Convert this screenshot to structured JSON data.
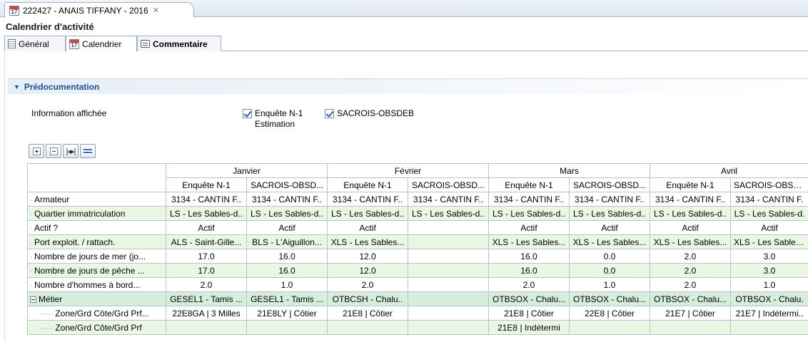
{
  "editor_tab": {
    "title": "222427 - ANAIS TIFFANY - 2016",
    "icon": "calendar-icon"
  },
  "form": {
    "title": "Calendrier d'activité"
  },
  "subtabs": [
    {
      "label": "Général",
      "icon": "document-icon"
    },
    {
      "label": "Calendrier",
      "icon": "calendar-icon"
    },
    {
      "label": "Commentaire",
      "icon": "comment-icon"
    }
  ],
  "section": {
    "title": "Prédocumentation"
  },
  "info": {
    "label": "Information affichée",
    "check1_line1": "Enquête N-1",
    "check1_line2": "Estimation",
    "check2": "SACROIS-OBSDEB"
  },
  "grid": {
    "months": [
      "Janvier",
      "Février",
      "Mars",
      "Avril"
    ],
    "subheaders": [
      "Enquête N-1",
      "SACROIS-OBSD...",
      "Enquête N-1",
      "SACROIS-OBSD...",
      "Enquête N-1",
      "SACROIS-OBSD...",
      "Enquête N-1",
      "SACROIS-OBSD..."
    ],
    "rows": [
      {
        "label": "Armateur",
        "style": "white",
        "cells": [
          "3134 - CANTIN F..",
          "3134 - CANTIN F..",
          "3134 - CANTIN F..",
          "3134 - CANTIN F..",
          "3134 - CANTIN F..",
          "3134 - CANTIN F..",
          "3134 - CANTIN F..",
          "3134 - CANTIN F."
        ]
      },
      {
        "label": "Quartier immatriculation",
        "style": "green",
        "cells": [
          "LS - Les Sables-d..",
          "LS - Les Sables-d..",
          "LS - Les Sables-d..",
          "LS - Les Sables-d..",
          "LS - Les Sables-d..",
          "LS - Les Sables-d..",
          "LS - Les Sables-d..",
          "LS - Les Sables-d."
        ]
      },
      {
        "label": "Actif ?",
        "style": "white",
        "cells": [
          "Actif",
          "Actif",
          "Actif",
          "",
          "Actif",
          "Actif",
          "Actif",
          "Actif"
        ]
      },
      {
        "label": "Port exploit. / rattach.",
        "style": "green",
        "cells": [
          "ALS - Saint-Gille...",
          "BLS - L'Aiguillon...",
          "XLS - Les Sables...",
          "",
          "XLS - Les Sables...",
          "XLS - Les Sables...",
          "XLS - Les Sables...",
          "XLS - Les Sables..."
        ]
      },
      {
        "label": "Nombre de jours de mer (jo...",
        "style": "white",
        "cells": [
          "17.0",
          "16.0",
          "12.0",
          "",
          "16.0",
          "0.0",
          "2.0",
          "3.0"
        ]
      },
      {
        "label": "Nombre de jours de pêche ...",
        "style": "green",
        "cells": [
          "17.0",
          "16.0",
          "12.0",
          "",
          "16.0",
          "0.0",
          "2.0",
          "3.0"
        ]
      },
      {
        "label": "Nombre d'hommes à bord...",
        "style": "white",
        "cells": [
          "2.0",
          "1.0",
          "2.0",
          "",
          "2.0",
          "1.0",
          "2.0",
          "1.0"
        ]
      },
      {
        "label": "Métier",
        "style": "group",
        "cells": [
          "GESEL1 - Tamis ...",
          "GESEL1 - Tamis ...",
          "OTBCSH - Chalu..",
          "",
          "OTBSOX - Chalu...",
          "OTBSOX - Chalu...",
          "OTBSOX - Chalu...",
          "OTBSOX - Chalu."
        ]
      },
      {
        "label": "Zone/Grd Côte/Grd Prf...",
        "style": "white",
        "cells": [
          "22E8GA | 3 Milles",
          "21E8LY | Côtier",
          "21E8 | Côtier",
          "",
          "21E8 | Côtier",
          "22E8 | Côtier",
          "21E7 | Côtier",
          "21E7 | Indétermi.."
        ]
      },
      {
        "label": "Zone/Grd Côte/Grd Prf",
        "style": "green",
        "cells": [
          "",
          "",
          "",
          "",
          "21E8 | Indétermi",
          "",
          "",
          ""
        ]
      }
    ]
  }
}
